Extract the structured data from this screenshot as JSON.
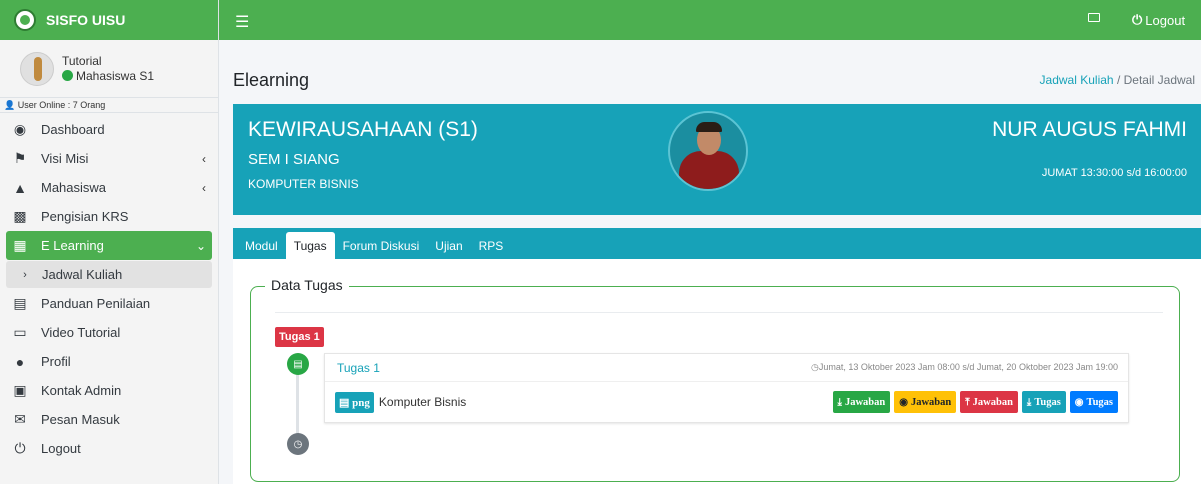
{
  "app": {
    "brand": "SISFO UISU"
  },
  "user": {
    "name": "Tutorial",
    "role": "Mahasiswa S1",
    "online": "User Online : 7 Orang"
  },
  "sidebar": {
    "items": [
      {
        "label": "Dashboard",
        "icon": "dashboard-icon"
      },
      {
        "label": "Visi Misi",
        "icon": "flag-icon"
      },
      {
        "label": "Mahasiswa",
        "icon": "graduation-cap-icon"
      },
      {
        "label": "Pengisian KRS",
        "icon": "word-file-icon"
      },
      {
        "label": "E Learning",
        "icon": "calendar-icon"
      },
      {
        "label": "Jadwal Kuliah",
        "icon": "chevron-right-icon"
      },
      {
        "label": "Panduan Penilaian",
        "icon": "book-icon"
      },
      {
        "label": "Video Tutorial",
        "icon": "monitor-icon"
      },
      {
        "label": "Profil",
        "icon": "user-icon"
      },
      {
        "label": "Kontak Admin",
        "icon": "contact-icon"
      },
      {
        "label": "Pesan Masuk",
        "icon": "envelope-icon"
      },
      {
        "label": "Logout",
        "icon": "power-icon"
      }
    ]
  },
  "topbar": {
    "logout": "Logout"
  },
  "header": {
    "title": "Elearning",
    "breadcrumb_link": "Jadwal Kuliah",
    "breadcrumb_sep": "/",
    "breadcrumb_current": "Detail Jadwal"
  },
  "course": {
    "name": "KEWIRAUSAHAAN (S1)",
    "class": "SEM I SIANG",
    "prodi": "KOMPUTER BISNIS",
    "lecturer": "NUR AUGUS FAHMI",
    "schedule": "JUMAT 13:30:00 s/d 16:00:00"
  },
  "tabs": [
    "Modul",
    "Tugas",
    "Forum Diskusi",
    "Ujian",
    "RPS"
  ],
  "tugas": {
    "legend": "Data Tugas",
    "label": "Tugas 1",
    "item_title": "Tugas 1",
    "time": "Jumat, 13 Oktober 2023 Jam 08:00 s/d Jumat, 20 Oktober 2023 Jam 19:00",
    "file_badge": "png",
    "file_name": "Komputer Bisnis",
    "buttons": [
      "Jawaban",
      "Jawaban",
      "Jawaban",
      "Tugas",
      "Tugas"
    ]
  },
  "colors": {
    "primary_green": "#4caf50",
    "info": "#17a2b8",
    "danger": "#dc3545",
    "warning": "#ffc107",
    "blue": "#007bff"
  }
}
